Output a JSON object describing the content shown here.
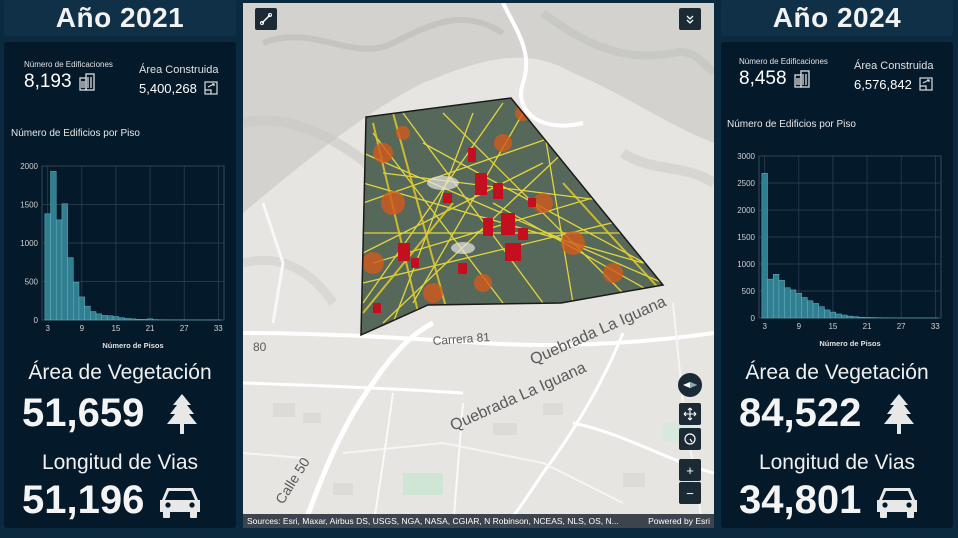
{
  "left": {
    "title": "Año 2021",
    "buildings_label": "Número de Edificaciones",
    "buildings_value": "8,193",
    "area_label": "Área Construida",
    "area_value": "5,400,268",
    "chart_title": "Número de Edificios por Piso",
    "vegetation_label": "Área de Vegetación",
    "vegetation_value": "51,659",
    "roads_label": "Longitud de Vias",
    "roads_value": "51,196"
  },
  "right": {
    "title": "Año 2024",
    "buildings_label": "Número de Edificaciones",
    "buildings_value": "8,458",
    "area_label": "Área Construida",
    "area_value": "6,576,842",
    "chart_title": "Número de Edificios por Piso",
    "vegetation_label": "Área de Vegetación",
    "vegetation_value": "84,522",
    "roads_label": "Longitud de Vias",
    "roads_value": "34,801"
  },
  "map": {
    "labels": [
      "Carrera 81",
      "Quebrada La Iguana",
      "Quebrada La Iguana",
      "Calle 50",
      "80"
    ],
    "attribution": "Sources: Esri, Maxar, Airbus DS, USGS, NGA, NASA, CGIAR, N Robinson, NCEAS, NLS, OS, N...",
    "powered_by": "Powered by Esri",
    "zoom_in": "+",
    "zoom_out": "−"
  },
  "chart_data": [
    {
      "type": "bar",
      "title": "",
      "xlabel": "Número de Pisos",
      "ylabel": "",
      "x_ticks": [
        3,
        9,
        15,
        21,
        27,
        33
      ],
      "y_ticks": [
        0,
        500,
        1000,
        1500,
        2000
      ],
      "ylim": [
        0,
        2000
      ],
      "xlim": [
        2,
        34
      ],
      "x": [
        3,
        4,
        5,
        6,
        7,
        8,
        9,
        10,
        11,
        12,
        13,
        14,
        15,
        16,
        17,
        18,
        19,
        20,
        21,
        22,
        23,
        24,
        25,
        26,
        27,
        28,
        29,
        30,
        31,
        32,
        33
      ],
      "values": [
        1380,
        1930,
        1300,
        1510,
        810,
        490,
        300,
        180,
        110,
        80,
        60,
        55,
        45,
        30,
        20,
        15,
        10,
        8,
        15,
        5,
        3,
        2,
        2,
        2,
        2,
        1,
        1,
        1,
        1,
        1,
        1
      ],
      "grid": true
    },
    {
      "type": "bar",
      "title": "",
      "xlabel": "Número de Pisos",
      "ylabel": "",
      "x_ticks": [
        3,
        9,
        15,
        21,
        27,
        33
      ],
      "y_ticks": [
        0,
        500,
        1000,
        1500,
        2000,
        2500,
        3000
      ],
      "ylim": [
        0,
        3000
      ],
      "xlim": [
        2,
        34
      ],
      "x": [
        3,
        4,
        5,
        6,
        7,
        8,
        9,
        10,
        11,
        12,
        13,
        14,
        15,
        16,
        17,
        18,
        19,
        20,
        21,
        22,
        23,
        24,
        25,
        26,
        27,
        28,
        29,
        30,
        31,
        32,
        33
      ],
      "values": [
        2680,
        720,
        810,
        700,
        560,
        520,
        460,
        380,
        320,
        270,
        210,
        150,
        110,
        75,
        55,
        35,
        25,
        15,
        10,
        8,
        5,
        3,
        2,
        2,
        1,
        1,
        1,
        1,
        1,
        1,
        1
      ],
      "grid": true
    }
  ],
  "colors": {
    "bar": "#2f7f91",
    "bar_edge": "#67b3c2",
    "panel": "#041a2a",
    "header": "#0f3047"
  }
}
